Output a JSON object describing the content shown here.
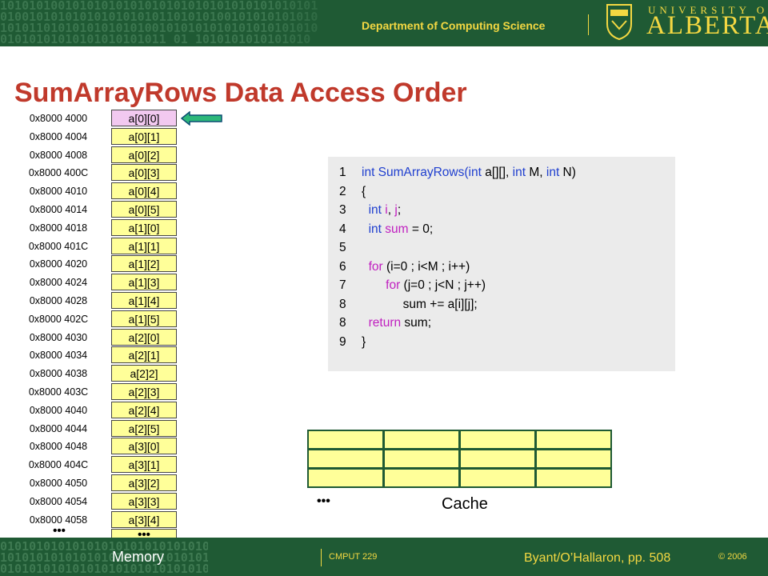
{
  "header": {
    "department": "Department of Computing Science",
    "university_top": "UNIVERSITY OF",
    "university_name": "ALBERTA",
    "background_color": "#1f5a34",
    "accent_color": "#f4d842"
  },
  "title": "SumArrayRows Data Access Order",
  "memory": {
    "rows": [
      {
        "address": "0x8000 4000",
        "element": "a[0][0]"
      },
      {
        "address": "0x8000 4004",
        "element": "a[0][1]"
      },
      {
        "address": "0x8000 4008",
        "element": "a[0][2]"
      },
      {
        "address": "0x8000 400C",
        "element": "a[0][3]"
      },
      {
        "address": "0x8000 4010",
        "element": "a[0][4]"
      },
      {
        "address": "0x8000 4014",
        "element": "a[0][5]"
      },
      {
        "address": "0x8000 4018",
        "element": "a[1][0]"
      },
      {
        "address": "0x8000 401C",
        "element": "a[1][1]"
      },
      {
        "address": "0x8000 4020",
        "element": "a[1][2]"
      },
      {
        "address": "0x8000 4024",
        "element": "a[1][3]"
      },
      {
        "address": "0x8000 4028",
        "element": "a[1][4]"
      },
      {
        "address": "0x8000 402C",
        "element": "a[1][5]"
      },
      {
        "address": "0x8000 4030",
        "element": "a[2][0]"
      },
      {
        "address": "0x8000 4034",
        "element": "a[2][1]"
      },
      {
        "address": "0x8000 4038",
        "element": "a[2]2]"
      },
      {
        "address": "0x8000 403C",
        "element": "a[2][3]"
      },
      {
        "address": "0x8000 4040",
        "element": "a[2][4]"
      },
      {
        "address": "0x8000 4044",
        "element": "a[2][5]"
      },
      {
        "address": "0x8000 4048",
        "element": "a[3][0]"
      },
      {
        "address": "0x8000 404C",
        "element": "a[3][1]"
      },
      {
        "address": "0x8000 4050",
        "element": "a[3][2]"
      },
      {
        "address": "0x8000 4054",
        "element": "a[3][3]"
      },
      {
        "address": "0x8000 4058",
        "element": "a[3][4]"
      }
    ],
    "ellipsis": "•••",
    "left_ellipsis": "•••",
    "label": "Memory",
    "highlight_color": "#f2c9f0",
    "cell_color": "#ffff99",
    "pointer_color": "#2db87a"
  },
  "code": {
    "lines": [
      {
        "num": "1",
        "tokens": [
          {
            "t": "int",
            "c": "kw"
          },
          {
            "t": " SumArrayRows(",
            "c": "kw"
          },
          {
            "t": "int",
            "c": "kw"
          },
          {
            "t": " a[][], ",
            "c": ""
          },
          {
            "t": "int",
            "c": "kw"
          },
          {
            "t": " M, ",
            "c": ""
          },
          {
            "t": "int",
            "c": "kw"
          },
          {
            "t": " N)",
            "c": ""
          }
        ]
      },
      {
        "num": "2",
        "tokens": [
          {
            "t": "{",
            "c": ""
          }
        ]
      },
      {
        "num": "3",
        "tokens": [
          {
            "t": "  int",
            "c": "kw"
          },
          {
            "t": " i",
            "c": "kw2"
          },
          {
            "t": ", ",
            "c": ""
          },
          {
            "t": "j",
            "c": "kw2"
          },
          {
            "t": ";",
            "c": ""
          }
        ]
      },
      {
        "num": "4",
        "tokens": [
          {
            "t": "  int",
            "c": "kw"
          },
          {
            "t": " sum",
            "c": "kw2"
          },
          {
            "t": " = 0;",
            "c": ""
          }
        ]
      },
      {
        "num": "5",
        "tokens": []
      },
      {
        "num": "6",
        "tokens": [
          {
            "t": "  for",
            "c": "kw2"
          },
          {
            "t": " (i=0 ; i<M ; i++)",
            "c": ""
          }
        ]
      },
      {
        "num": "7",
        "tokens": [
          {
            "t": "       for",
            "c": "kw2"
          },
          {
            "t": " (j=0 ; j<N ; j++)",
            "c": ""
          }
        ]
      },
      {
        "num": "8",
        "tokens": [
          {
            "t": "            sum += a[i][j];",
            "c": ""
          }
        ]
      },
      {
        "num": "8",
        "tokens": [
          {
            "t": "  return",
            "c": "kw2"
          },
          {
            "t": " sum;",
            "c": ""
          }
        ]
      },
      {
        "num": "9",
        "tokens": [
          {
            "t": "}",
            "c": ""
          }
        ]
      }
    ]
  },
  "cache": {
    "rows": 3,
    "cols": 4,
    "ellipsis": "•••",
    "label": "Cache"
  },
  "footer": {
    "course": "CMPUT 229",
    "reference": "Byant/O’Hallaron, pp. 508",
    "copyright": "© 2006"
  }
}
